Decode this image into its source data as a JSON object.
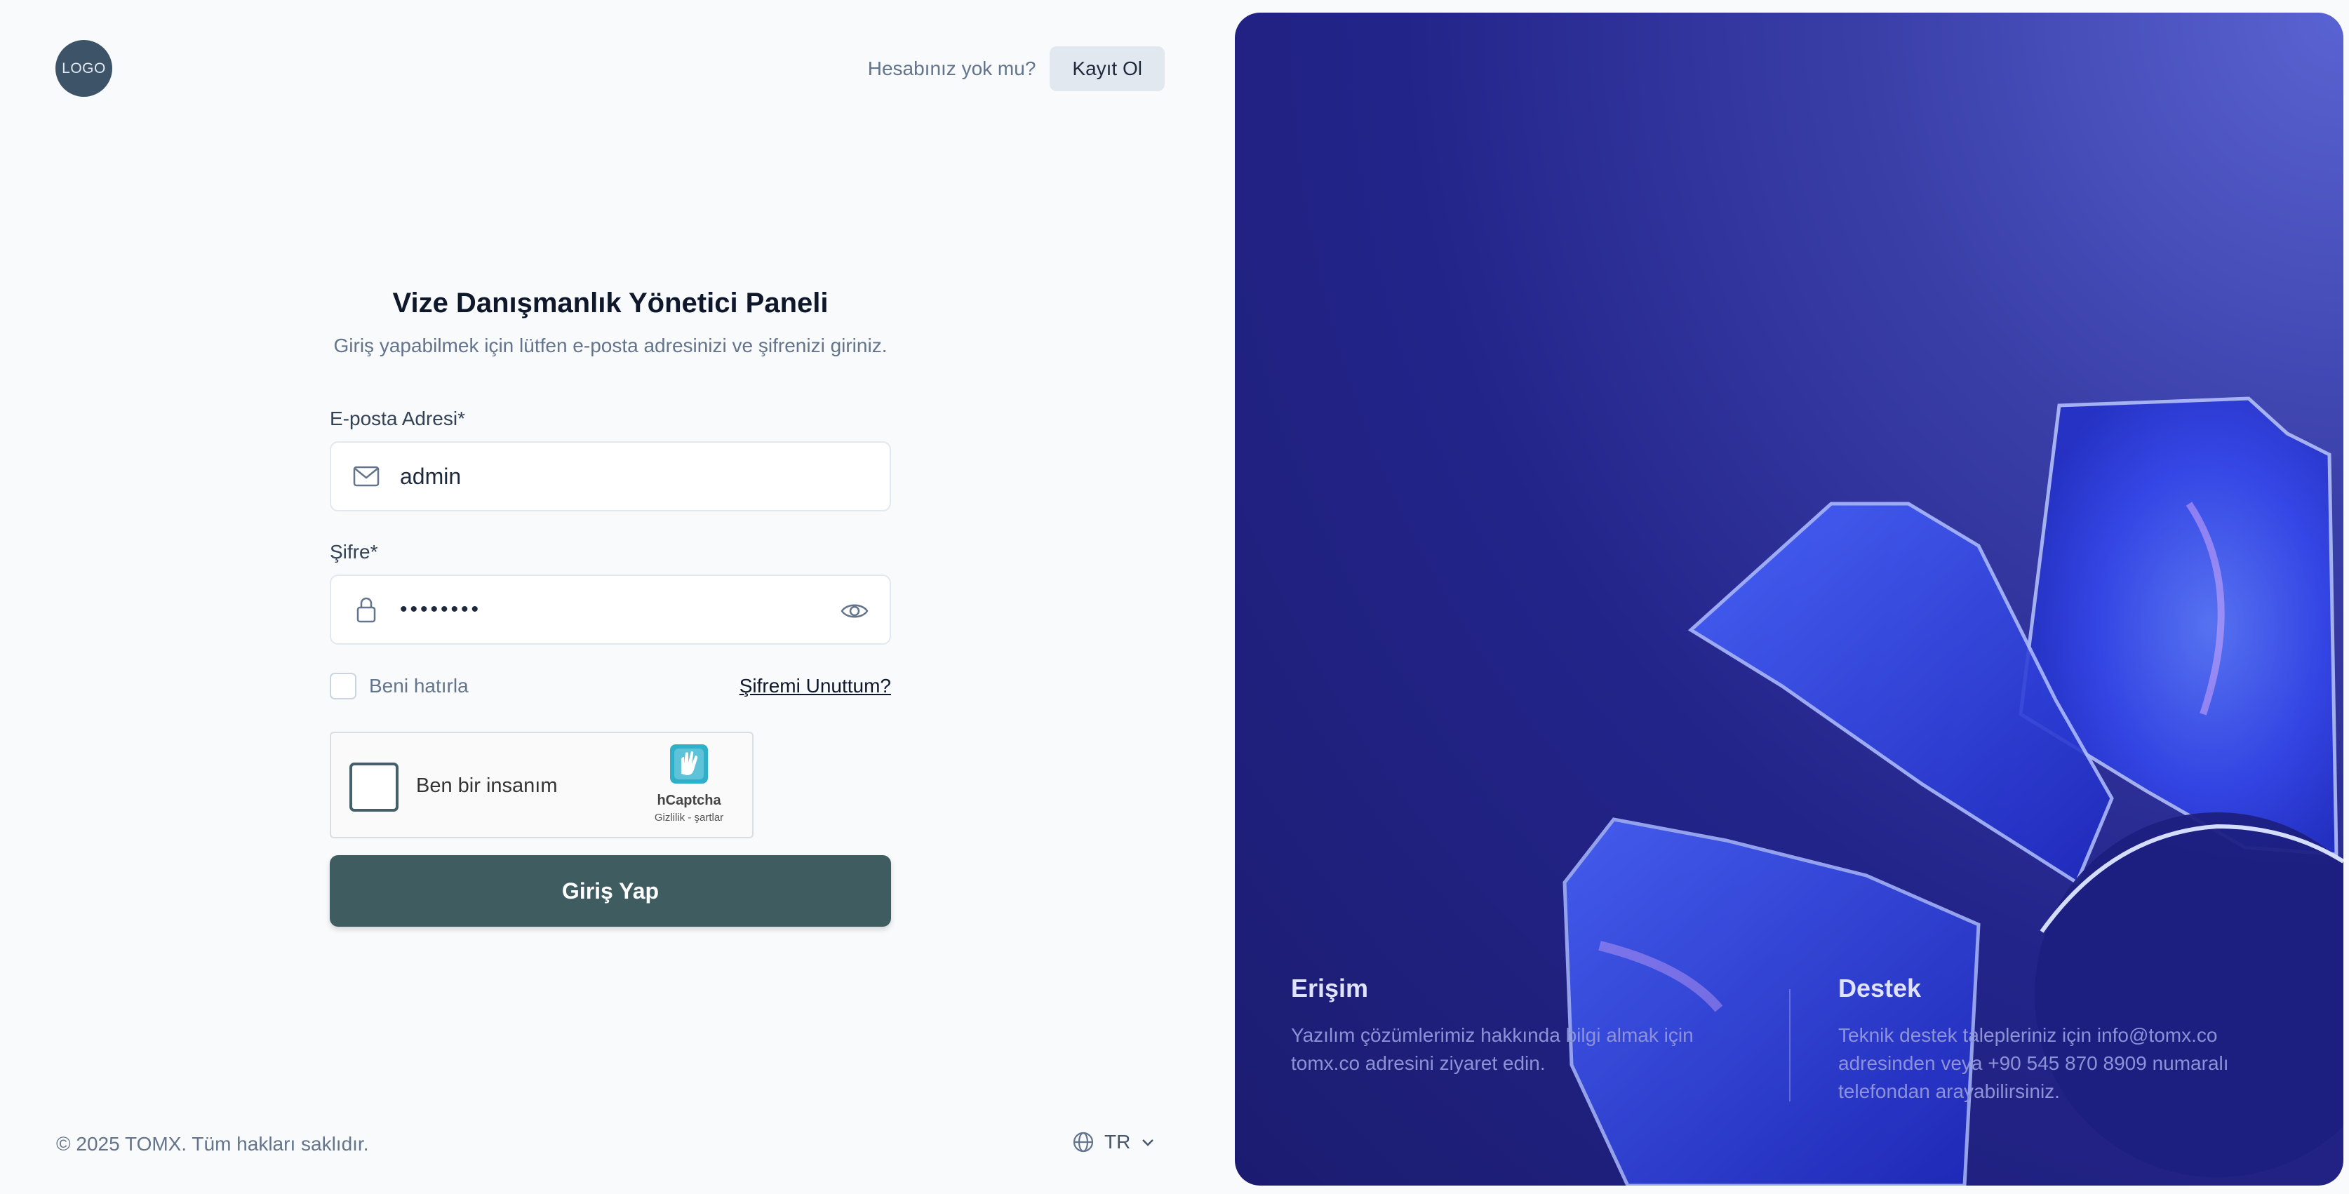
{
  "logo": {
    "text": "LOGO"
  },
  "header": {
    "question": "Hesabınız yok mu?",
    "signup_label": "Kayıt Ol"
  },
  "form": {
    "title": "Vize Danışmanlık Yönetici Paneli",
    "subtitle": "Giriş yapabilmek için lütfen e-posta adresinizi ve şifrenizi giriniz.",
    "email_label": "E-posta Adresi*",
    "email_value": "admin",
    "password_label": "Şifre*",
    "password_value": "••••••••",
    "remember_label": "Beni hatırla",
    "forgot_label": "Şifremi Unuttum?",
    "submit_label": "Giriş Yap"
  },
  "captcha": {
    "label": "Ben bir insanım",
    "brand": "hCaptcha",
    "terms": "Gizlilik - şartlar"
  },
  "footer": {
    "copyright": "© 2025 TOMX. Tüm hakları saklıdır.",
    "language": "TR"
  },
  "panel": {
    "access_title": "Erişim",
    "access_text": "Yazılım çözümlerimiz hakkında bilgi almak için tomx.co adresini ziyaret edin.",
    "support_title": "Destek",
    "support_text": "Teknik destek talepleriniz için info@tomx.co adresinden veya +90 545 870 8909 numaralı telefondan arayabilirsiniz."
  },
  "colors": {
    "primary": "#3f5d61",
    "panel_bg": "#23248a",
    "accent": "#3a5bff"
  }
}
